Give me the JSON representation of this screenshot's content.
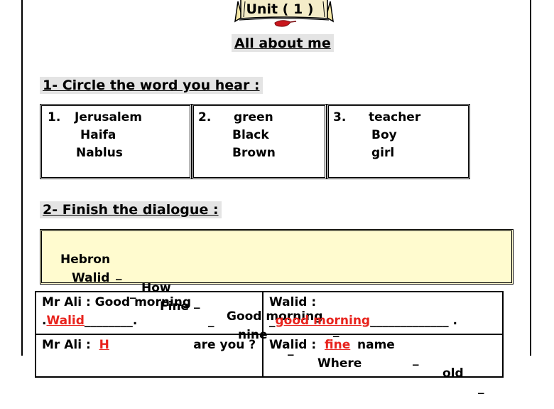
{
  "header": {
    "unit_label": "Unit ( 1 )",
    "subtitle": "All about me"
  },
  "section1": {
    "title": "1- Circle the word you hear :",
    "groups": [
      {
        "number": "1.",
        "words": [
          "Jerusalem",
          "Haifa",
          "Nablus"
        ]
      },
      {
        "number": "2.",
        "words": [
          "green",
          "Black",
          "Brown"
        ]
      },
      {
        "number": "3.",
        "words": [
          "teacher",
          "Boy",
          "girl"
        ]
      }
    ]
  },
  "section2": {
    "title": "2- Finish the dialogue :",
    "word_bank": {
      "row1": [
        "Hebron",
        "How",
        "Good morning",
        "name",
        "old"
      ],
      "row2": [
        "Walid",
        "Fine",
        "nine",
        "Where"
      ],
      "separator": "_"
    },
    "dialogue": [
      {
        "left": {
          "speaker": "Mr Ali :",
          "text": "Good morning",
          "prefix": ".",
          "answer": "Walid",
          "suffix": "________."
        },
        "right": {
          "speaker": "Walid :",
          "text": "",
          "prefix": "_",
          "answer": "good morning",
          "suffix": "_____________ ."
        }
      },
      {
        "left": {
          "speaker": "Mr Ali :",
          "answer": "H",
          "text": "are you ?"
        },
        "right": {
          "speaker": "Walid :",
          "answer": "fine"
        }
      }
    ]
  },
  "colors": {
    "heading_bg": "#e4e4e4",
    "word_bank_bg": "#fffbcf",
    "answer": "#e8231d"
  }
}
